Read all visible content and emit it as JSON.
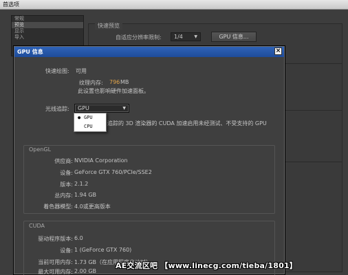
{
  "window": {
    "title": "首选项"
  },
  "categories": [
    {
      "label": "常规",
      "selected": false
    },
    {
      "label": "预览",
      "selected": true
    },
    {
      "label": "显示",
      "selected": false
    },
    {
      "label": "导入",
      "selected": false
    }
  ],
  "preview_group": {
    "title": "快速预览",
    "adaptive_label": "自适应分辨率限制:",
    "adaptive_value": "1/4",
    "gpu_info_button": "GPU 信息..."
  },
  "dialog": {
    "title": "GPU 信息",
    "fast_draft_label": "快速绘图:",
    "fast_draft_value": "可用",
    "texture_mem_label": "纹理内存:",
    "texture_mem_value": "796",
    "texture_mem_unit": "MB",
    "hw_note": "此设置也影响硬件加速面板。",
    "raytrace_label": "光线追踪:",
    "raytrace_value": "GPU",
    "raytrace_options": [
      "GPU",
      "CPU"
    ],
    "raytrace_note": "追踪的 3D 渲染器的 CUDA 加速启用未经测试、不受支持的 GPU",
    "opengl": {
      "title": "OpenGL",
      "rows": [
        {
          "label": "供应商:",
          "value": "NVIDIA Corporation"
        },
        {
          "label": "设备:",
          "value": "GeForce GTX 760/PCIe/SSE2"
        },
        {
          "label": "版本:",
          "value": "2.1.2"
        },
        {
          "label": "总内存:",
          "value": "1.94 GB"
        },
        {
          "label": "着色器模型:",
          "value": "4.0或更高版本"
        }
      ]
    },
    "cuda": {
      "title": "CUDA",
      "rows": [
        {
          "label": "驱动程序版本:",
          "value": "6.0"
        },
        {
          "label": "设备:",
          "value": "1 (GeForce GTX 760)"
        },
        {
          "label": "当前可用内存:",
          "value": "1.73 GB（在应用程序启动时）"
        },
        {
          "label": "最大可用内存:",
          "value": "2.00 GB"
        }
      ]
    }
  },
  "watermark": "AE交流区吧 【www.linecg.com/tieba/1801】"
}
